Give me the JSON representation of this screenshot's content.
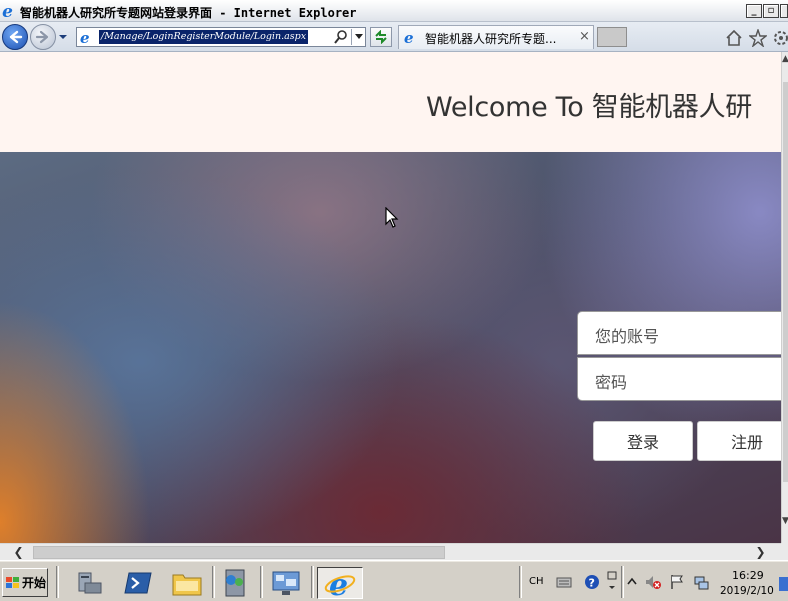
{
  "window": {
    "title": "智能机器人研究所专题网站登录界面 - Internet Explorer",
    "min_label": "_",
    "max_label": "▫",
    "close_label": "×"
  },
  "navbar": {
    "url": "/Manage/LoginRegisterModule/Login.aspx",
    "tab_title": "智能机器人研究所专题...",
    "tab_close": "×"
  },
  "page": {
    "welcome": "Welcome To 智能机器人研",
    "account_placeholder": "您的账号",
    "password_placeholder": "密码",
    "login_label": "登录",
    "register_label": "注册"
  },
  "taskbar": {
    "start_label": "开始",
    "lang": "CH",
    "time": "16:29",
    "date": "2019/2/10"
  },
  "colors": {
    "header_bg": "#fff5f1",
    "taskbar_bg": "#d4d0c8",
    "selection": "#0a246a"
  }
}
